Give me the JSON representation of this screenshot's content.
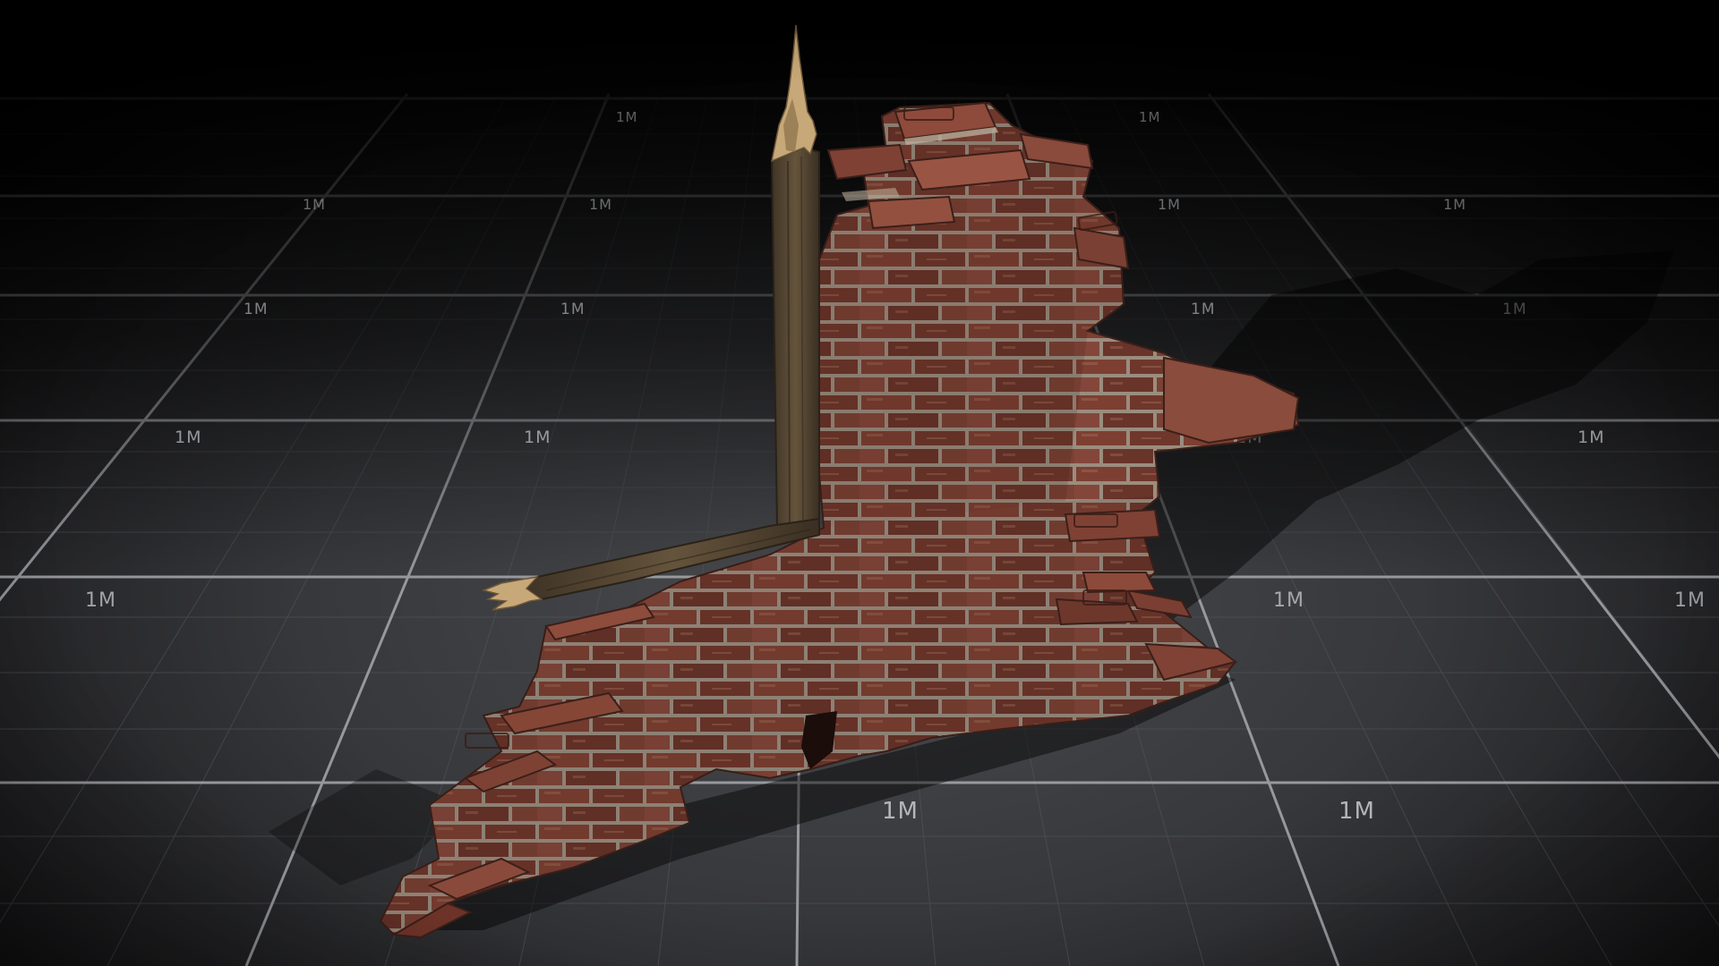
{
  "scene": {
    "subject": "broken-brick-wall-with-wooden-post",
    "floor": {
      "grid_unit_label": "1M",
      "grid_labels": [
        {
          "text": "1M"
        },
        {
          "text": "1M"
        },
        {
          "text": "1M"
        },
        {
          "text": "1M"
        },
        {
          "text": "1M"
        },
        {
          "text": "1M"
        },
        {
          "text": "1M"
        },
        {
          "text": "1M"
        },
        {
          "text": "1M"
        },
        {
          "text": "1M"
        },
        {
          "text": "1M"
        },
        {
          "text": "1M"
        },
        {
          "text": "1M"
        },
        {
          "text": "1M"
        },
        {
          "text": "1M"
        },
        {
          "text": "1M"
        },
        {
          "text": "1M"
        },
        {
          "text": "1M"
        },
        {
          "text": "1M"
        },
        {
          "text": "1M"
        },
        {
          "text": "1M"
        },
        {
          "text": "1M"
        },
        {
          "text": "1M"
        },
        {
          "text": "1M"
        }
      ]
    },
    "colors": {
      "background": "#0b0b0c",
      "floor": "#3a3b3e",
      "grid_major": "#9a9ca0",
      "grid_minor": "#55575b",
      "brick": "#7a3e31",
      "brick_dark": "#4e2620",
      "mortar": "#9a8e80",
      "wood": "#5a4b36",
      "wood_splinter": "#c9ab7c"
    }
  }
}
